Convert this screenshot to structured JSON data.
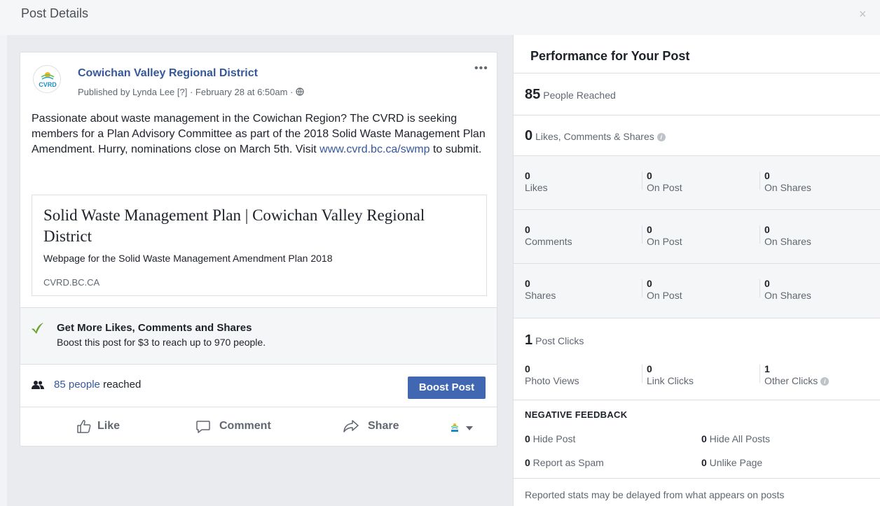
{
  "header": {
    "title": "Post Details",
    "close": "×"
  },
  "post": {
    "page_name": "Cowichan Valley Regional District",
    "meta": "Published by Lynda Lee [?] · February 28 at 6:50am · ",
    "more": "•••",
    "avatar_text": "CVRD",
    "body_before_link": "Passionate about waste management in the Cowichan Region? The CVRD is seeking members for a Plan Advisory Committee as part of the 2018 Solid Waste Management Plan Amendment. Hurry, nominations close on March 5th. Visit ",
    "body_link": "www.cvrd.bc.ca/swmp",
    "body_after_link": " to submit.",
    "link_card": {
      "title": "Solid Waste Management Plan | Cowichan Valley Regional District",
      "description": "Webpage for the Solid Waste Management Amendment Plan 2018",
      "domain": "CVRD.BC.CA"
    },
    "promo": {
      "title": "Get More Likes, Comments and Shares",
      "subtitle": "Boost this post for $3 to reach up to 970 people."
    },
    "reach": {
      "link": "85 people",
      "suffix": " reached"
    },
    "boost_button": "Boost Post",
    "actions": {
      "like": "Like",
      "comment": "Comment",
      "share": "Share"
    }
  },
  "performance": {
    "title": "Performance for Your Post",
    "people_reached": {
      "value": "85",
      "label": "People Reached"
    },
    "engagement": {
      "value": "0",
      "label": "Likes, Comments & Shares"
    },
    "rows": [
      {
        "cells": [
          {
            "num": "0",
            "label": "Likes"
          },
          {
            "num": "0",
            "label": "On Post"
          },
          {
            "num": "0",
            "label": "On Shares"
          }
        ]
      },
      {
        "cells": [
          {
            "num": "0",
            "label": "Comments"
          },
          {
            "num": "0",
            "label": "On Post"
          },
          {
            "num": "0",
            "label": "On Shares"
          }
        ]
      },
      {
        "cells": [
          {
            "num": "0",
            "label": "Shares"
          },
          {
            "num": "0",
            "label": "On Post"
          },
          {
            "num": "0",
            "label": "On Shares"
          }
        ]
      }
    ],
    "post_clicks": {
      "value": "1",
      "label": "Post Clicks"
    },
    "click_cells": [
      {
        "num": "0",
        "label": "Photo Views"
      },
      {
        "num": "0",
        "label": "Link Clicks"
      },
      {
        "num": "1",
        "label": "Other Clicks"
      }
    ],
    "negative": {
      "title": "NEGATIVE FEEDBACK",
      "items": [
        {
          "num": "0",
          "label": " Hide Post"
        },
        {
          "num": "0",
          "label": " Hide All Posts"
        },
        {
          "num": "0",
          "label": " Report as Spam"
        },
        {
          "num": "0",
          "label": " Unlike Page"
        }
      ]
    },
    "disclaimer": "Reported stats may be delayed from what appears on posts"
  },
  "colors": {
    "brand_blue": "#4267b2",
    "link_blue": "#365899",
    "promo_green": "#69a32c"
  }
}
